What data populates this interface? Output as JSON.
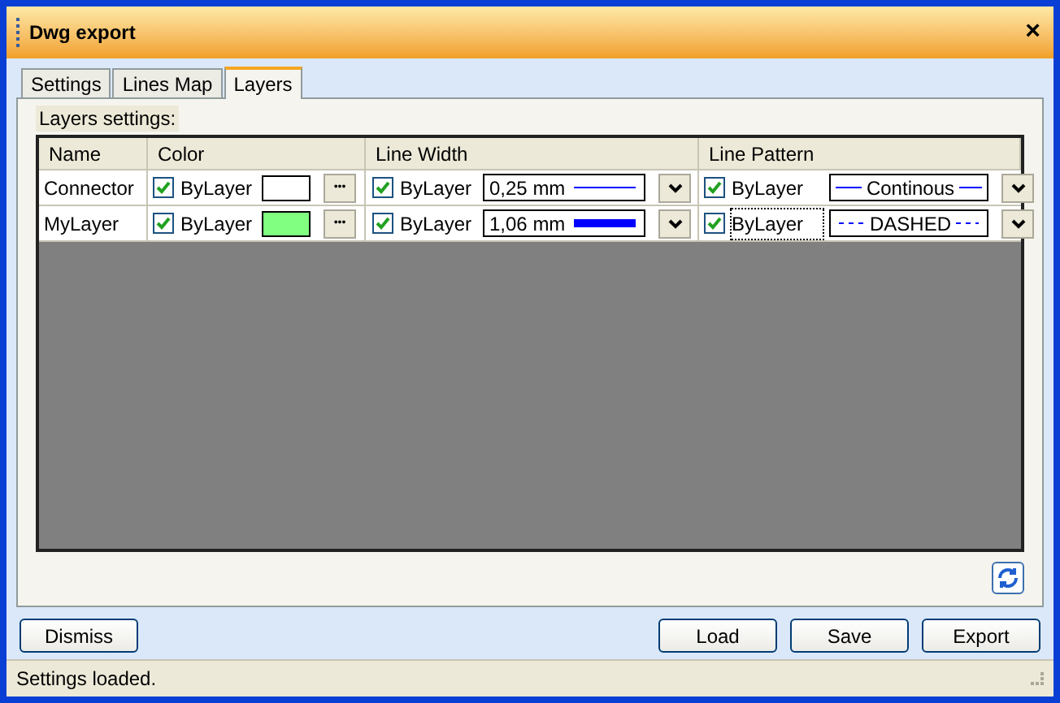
{
  "window": {
    "title": "Dwg export",
    "close": "×"
  },
  "tabs": [
    {
      "label": "Settings",
      "selected": false
    },
    {
      "label": "Lines Map",
      "selected": false
    },
    {
      "label": "Layers",
      "selected": true
    }
  ],
  "section_label": "Layers settings:",
  "table": {
    "columns": [
      "Name",
      "Color",
      "Line Width",
      "Line Pattern"
    ],
    "rows": [
      {
        "name": "Connector",
        "color": {
          "by_layer": true,
          "label": "ByLayer",
          "color": "#ffffff",
          "more": "•••"
        },
        "width": {
          "by_layer": true,
          "label": "ByLayer",
          "value": "0,25 mm",
          "kind": "thin"
        },
        "pattern": {
          "by_layer": true,
          "label": "ByLayer",
          "focused": false,
          "value": "Continous",
          "kind": "solid"
        }
      },
      {
        "name": "MyLayer",
        "color": {
          "by_layer": true,
          "label": "ByLayer",
          "color": "#80ff80",
          "more": "•••"
        },
        "width": {
          "by_layer": true,
          "label": "ByLayer",
          "value": "1,06 mm",
          "kind": "thick"
        },
        "pattern": {
          "by_layer": true,
          "label": "ByLayer",
          "focused": true,
          "value": "DASHED",
          "kind": "dashed"
        }
      }
    ]
  },
  "buttons_left": [
    "Dismiss"
  ],
  "buttons_right": [
    "Load",
    "Save",
    "Export"
  ],
  "status_bar": "Settings loaded."
}
